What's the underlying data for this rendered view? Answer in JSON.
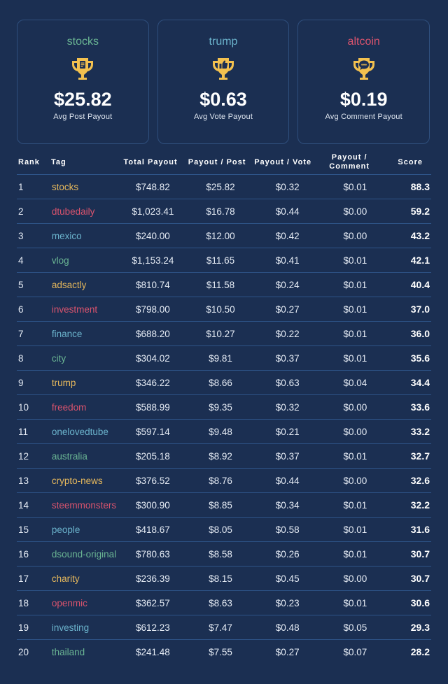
{
  "colors": {
    "background": "#1b2f52",
    "card_border": "#2f4f7d",
    "trophy": "#f3c14f",
    "tag_gold": "#e6b85c",
    "tag_red": "#d9536d",
    "tag_blue": "#6bb3cc",
    "tag_green": "#6ab593"
  },
  "cards": [
    {
      "tag": "stocks",
      "tag_color": "#6ab593",
      "icon": "trophy-document-icon",
      "value": "$25.82",
      "label": "Avg Post Payout"
    },
    {
      "tag": "trump",
      "tag_color": "#6bb3cc",
      "icon": "trophy-thumbs-up-icon",
      "value": "$0.63",
      "label": "Avg Vote Payout"
    },
    {
      "tag": "altcoin",
      "tag_color": "#d9536d",
      "icon": "trophy-chat-icon",
      "value": "$0.19",
      "label": "Avg Comment Payout"
    }
  ],
  "table": {
    "headers": {
      "rank": "Rank",
      "tag": "Tag",
      "total": "Total Payout",
      "post": "Payout / Post",
      "vote": "Payout / Vote",
      "comment": "Payout / Comment",
      "score": "Score"
    },
    "rows": [
      {
        "rank": "1",
        "tag": "stocks",
        "total": "$748.82",
        "post": "$25.82",
        "vote": "$0.32",
        "comment": "$0.01",
        "score": "88.3"
      },
      {
        "rank": "2",
        "tag": "dtubedaily",
        "total": "$1,023.41",
        "post": "$16.78",
        "vote": "$0.44",
        "comment": "$0.00",
        "score": "59.2"
      },
      {
        "rank": "3",
        "tag": "mexico",
        "total": "$240.00",
        "post": "$12.00",
        "vote": "$0.42",
        "comment": "$0.00",
        "score": "43.2"
      },
      {
        "rank": "4",
        "tag": "vlog",
        "total": "$1,153.24",
        "post": "$11.65",
        "vote": "$0.41",
        "comment": "$0.01",
        "score": "42.1"
      },
      {
        "rank": "5",
        "tag": "adsactly",
        "total": "$810.74",
        "post": "$11.58",
        "vote": "$0.24",
        "comment": "$0.01",
        "score": "40.4"
      },
      {
        "rank": "6",
        "tag": "investment",
        "total": "$798.00",
        "post": "$10.50",
        "vote": "$0.27",
        "comment": "$0.01",
        "score": "37.0"
      },
      {
        "rank": "7",
        "tag": "finance",
        "total": "$688.20",
        "post": "$10.27",
        "vote": "$0.22",
        "comment": "$0.01",
        "score": "36.0"
      },
      {
        "rank": "8",
        "tag": "city",
        "total": "$304.02",
        "post": "$9.81",
        "vote": "$0.37",
        "comment": "$0.01",
        "score": "35.6"
      },
      {
        "rank": "9",
        "tag": "trump",
        "total": "$346.22",
        "post": "$8.66",
        "vote": "$0.63",
        "comment": "$0.04",
        "score": "34.4"
      },
      {
        "rank": "10",
        "tag": "freedom",
        "total": "$588.99",
        "post": "$9.35",
        "vote": "$0.32",
        "comment": "$0.00",
        "score": "33.6"
      },
      {
        "rank": "11",
        "tag": "onelovedtube",
        "total": "$597.14",
        "post": "$9.48",
        "vote": "$0.21",
        "comment": "$0.00",
        "score": "33.2"
      },
      {
        "rank": "12",
        "tag": "australia",
        "total": "$205.18",
        "post": "$8.92",
        "vote": "$0.37",
        "comment": "$0.01",
        "score": "32.7"
      },
      {
        "rank": "13",
        "tag": "crypto-news",
        "total": "$376.52",
        "post": "$8.76",
        "vote": "$0.44",
        "comment": "$0.00",
        "score": "32.6"
      },
      {
        "rank": "14",
        "tag": "steemmonsters",
        "total": "$300.90",
        "post": "$8.85",
        "vote": "$0.34",
        "comment": "$0.01",
        "score": "32.2"
      },
      {
        "rank": "15",
        "tag": "people",
        "total": "$418.67",
        "post": "$8.05",
        "vote": "$0.58",
        "comment": "$0.01",
        "score": "31.6"
      },
      {
        "rank": "16",
        "tag": "dsound-original",
        "total": "$780.63",
        "post": "$8.58",
        "vote": "$0.26",
        "comment": "$0.01",
        "score": "30.7"
      },
      {
        "rank": "17",
        "tag": "charity",
        "total": "$236.39",
        "post": "$8.15",
        "vote": "$0.45",
        "comment": "$0.00",
        "score": "30.7"
      },
      {
        "rank": "18",
        "tag": "openmic",
        "total": "$362.57",
        "post": "$8.63",
        "vote": "$0.23",
        "comment": "$0.01",
        "score": "30.6"
      },
      {
        "rank": "19",
        "tag": "investing",
        "total": "$612.23",
        "post": "$7.47",
        "vote": "$0.48",
        "comment": "$0.05",
        "score": "29.3"
      },
      {
        "rank": "20",
        "tag": "thailand",
        "total": "$241.48",
        "post": "$7.55",
        "vote": "$0.27",
        "comment": "$0.07",
        "score": "28.2"
      }
    ]
  }
}
